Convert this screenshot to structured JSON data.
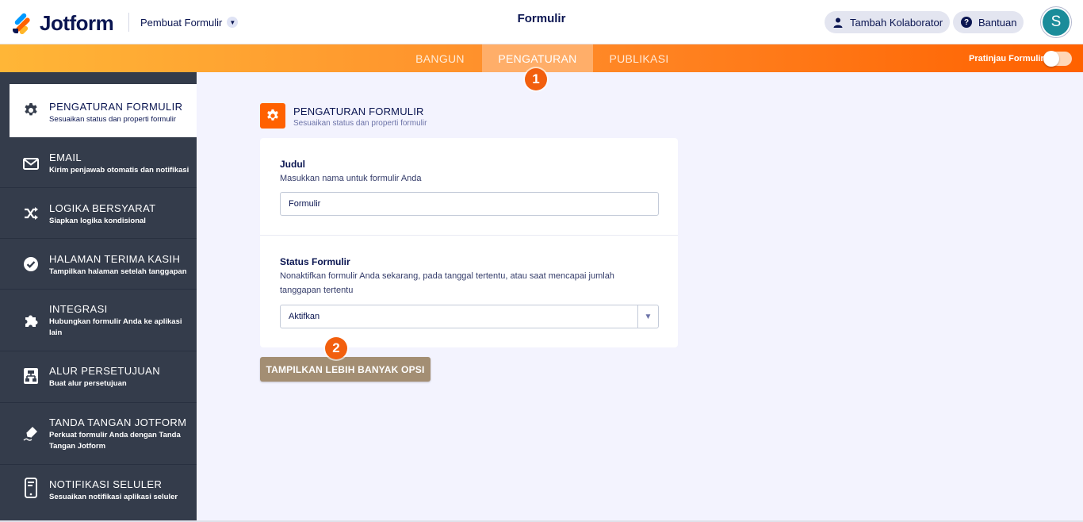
{
  "header": {
    "logo_text": "Jotform",
    "builder_menu": "Pembuat Formulir",
    "form_title": "Formulir",
    "collaborator_label": "Tambah Kolaborator",
    "help_label": "Bantuan",
    "avatar_initial": "S"
  },
  "nav": {
    "tabs": [
      {
        "label": "BANGUN"
      },
      {
        "label": "PENGATURAN"
      },
      {
        "label": "PUBLIKASI"
      }
    ],
    "preview_label": "Pratinjau Formulir"
  },
  "badges": [
    "1",
    "2"
  ],
  "sidebar": {
    "items": [
      {
        "title": "PENGATURAN FORMULIR",
        "desc": "Sesuaikan status dan properti formulir",
        "icon": "gear-icon",
        "active": true
      },
      {
        "title": "EMAIL",
        "desc": "Kirim penjawab otomatis dan notifikasi",
        "icon": "envelope-icon"
      },
      {
        "title": "LOGIKA BERSYARAT",
        "desc": "Siapkan logika kondisional",
        "icon": "shuffle-icon"
      },
      {
        "title": "HALAMAN TERIMA KASIH",
        "desc": "Tampilkan halaman setelah tanggapan",
        "icon": "check-circle-icon"
      },
      {
        "title": "INTEGRASI",
        "desc": "Hubungkan formulir Anda ke aplikasi lain",
        "icon": "puzzle-icon"
      },
      {
        "title": "ALUR PERSETUJUAN",
        "desc": "Buat alur persetujuan",
        "icon": "flow-icon"
      },
      {
        "title": "TANDA TANGAN JOTFORM",
        "desc": "Perkuat formulir Anda dengan Tanda Tangan Jotform",
        "icon": "pen-icon"
      },
      {
        "title": "NOTIFIKASI SELULER",
        "desc": "Sesuaikan notifikasi aplikasi seluler",
        "icon": "mobile-icon"
      }
    ]
  },
  "main": {
    "section_title": "PENGATURAN FORMULIR",
    "section_subtitle": "Sesuaikan status dan properti formulir",
    "title_field": {
      "label": "Judul",
      "description": "Masukkan nama untuk formulir Anda",
      "value": "Formulir"
    },
    "status_field": {
      "label": "Status Formulir",
      "description": "Nonaktifkan formulir Anda sekarang, pada tanggal tertentu, atau saat mencapai jumlah tanggapan tertentu",
      "value": "Aktifkan"
    },
    "more_button": "TAMPILKAN LEBIH BANYAK OPSI"
  },
  "colors": {
    "accent": "#ff6100",
    "sidebar_bg": "#343c4b",
    "navy": "#0a1551",
    "more_button": "#a38e73",
    "avatar": "#1b8c9a"
  }
}
